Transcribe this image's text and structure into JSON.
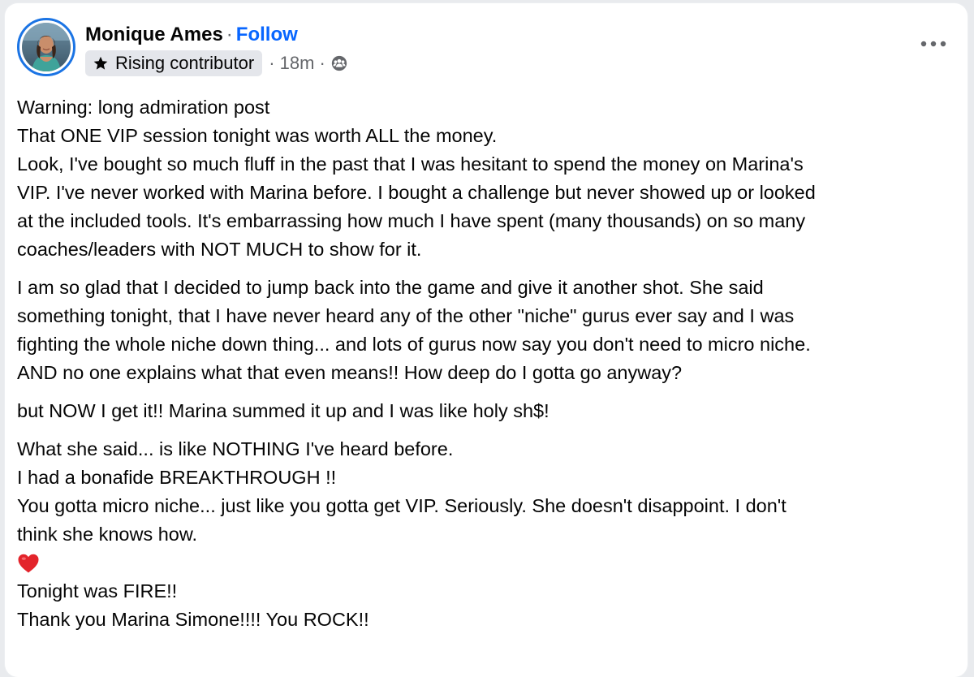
{
  "post": {
    "author": {
      "name": "Monique Ames",
      "separator": "·",
      "follow_label": "Follow"
    },
    "meta": {
      "badge_label": "Rising contributor",
      "badge_icon": "star-icon",
      "time_text": "· 18m ·",
      "audience_icon": "group-audience-icon"
    },
    "more_icon": "more-options-icon",
    "colors": {
      "link_blue": "#0866ff",
      "avatar_ring": "#1b74e4",
      "badge_bg": "#e4e6eb",
      "muted_text": "#65676b",
      "heart_red": "#e3242b"
    },
    "paragraphs": [
      {
        "lines": [
          "Warning: long admiration post",
          "That ONE VIP session tonight was worth ALL the money.",
          "Look, I've bought so much fluff in the past that I was hesitant to spend the money on Marina's",
          "VIP. I've never worked with Marina before. I bought a challenge but never showed up or looked",
          "at the included tools. It's embarrassing how much I have spent (many thousands) on so many",
          "coaches/leaders with NOT MUCH to show for it."
        ]
      },
      {
        "lines": [
          "I am so glad that I decided to jump back into the game and give it another shot. She said",
          "something tonight, that I have never heard any of the other \"niche\" gurus ever say and I was",
          "fighting the whole niche down thing... and lots of gurus now say you don't need to micro niche.",
          "AND no one explains what that even means!! How deep do I gotta go anyway?"
        ]
      },
      {
        "lines": [
          "but NOW I get it!! Marina summed it up and I was like holy sh$!"
        ]
      },
      {
        "lines": [
          "What she said... is like NOTHING I've heard before.",
          "I had a bonafide BREAKTHROUGH !!",
          "You gotta micro niche... just like you gotta get VIP. Seriously. She doesn't disappoint. I don't",
          "think she knows how."
        ],
        "emoji": "heart-emoji",
        "after_emoji_lines": [
          "Tonight was FIRE!!",
          "Thank you Marina Simone!!!! You ROCK!!"
        ]
      }
    ]
  }
}
